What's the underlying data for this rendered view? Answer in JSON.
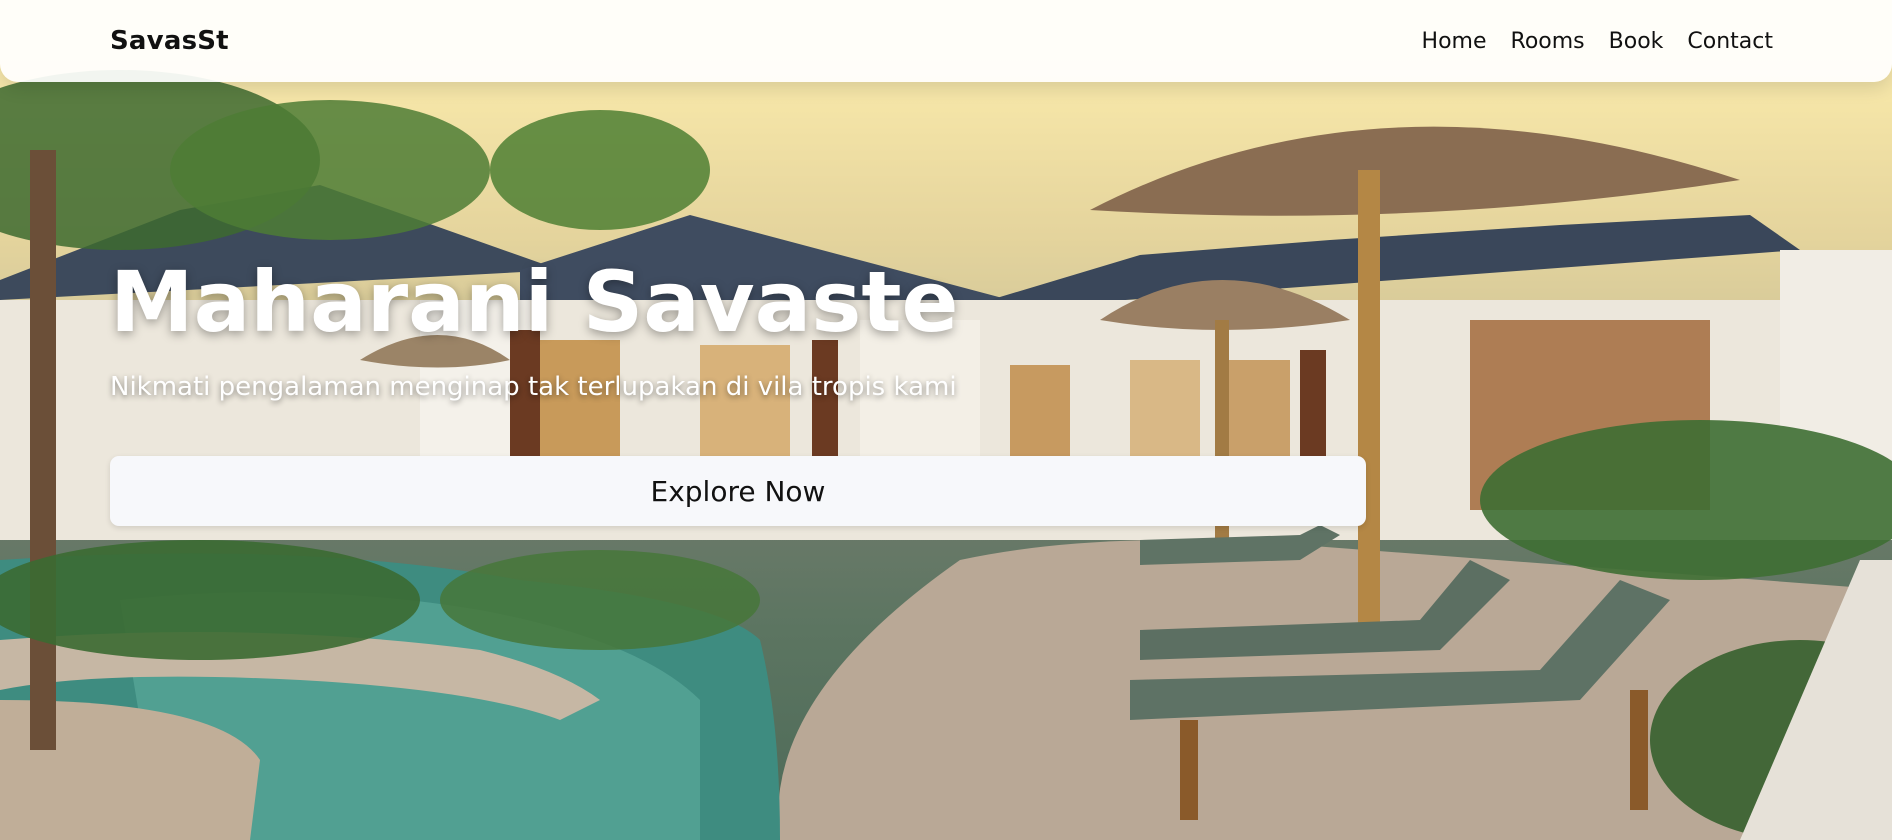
{
  "brand": {
    "name": "SavasSt"
  },
  "nav": {
    "items": [
      {
        "label": "Home"
      },
      {
        "label": "Rooms"
      },
      {
        "label": "Book"
      },
      {
        "label": "Contact"
      }
    ]
  },
  "hero": {
    "title": "Maharani Savaste",
    "subtitle": "Nikmati pengalaman menginap tak terlupakan di vila tropis kami",
    "cta_label": "Explore Now",
    "background_description_icon": "tropical-villa-pool-photo"
  },
  "colors": {
    "navbar_bg": "#ffffff",
    "text_dark": "#111111",
    "text_light": "#ffffff",
    "button_bg": "#f7f8fb"
  }
}
